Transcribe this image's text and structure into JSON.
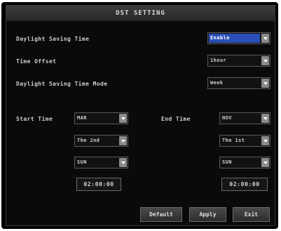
{
  "dialog": {
    "title": "DST SETTING"
  },
  "fields": {
    "daylight_saving_time": {
      "label": "Daylight Saving Time",
      "value": "Enable"
    },
    "time_offset": {
      "label": "Time Offset",
      "value": "1hour"
    },
    "daylight_saving_time_mode": {
      "label": "Daylight Saving Time Mode",
      "value": "Week"
    }
  },
  "start": {
    "label": "Start Time",
    "month": "MAR",
    "week": "The 2nd",
    "day": "SUN",
    "time": "02:00:00"
  },
  "end": {
    "label": "End Time",
    "month": "NOV",
    "week": "The 1st",
    "day": "SUN",
    "time": "02:00:00"
  },
  "buttons": {
    "default": "Default",
    "apply": "Apply",
    "exit": "Exit"
  },
  "colors": {
    "highlight": "#2a4fb8",
    "background": "#0a0a0a",
    "text": "#cfcfcf"
  }
}
